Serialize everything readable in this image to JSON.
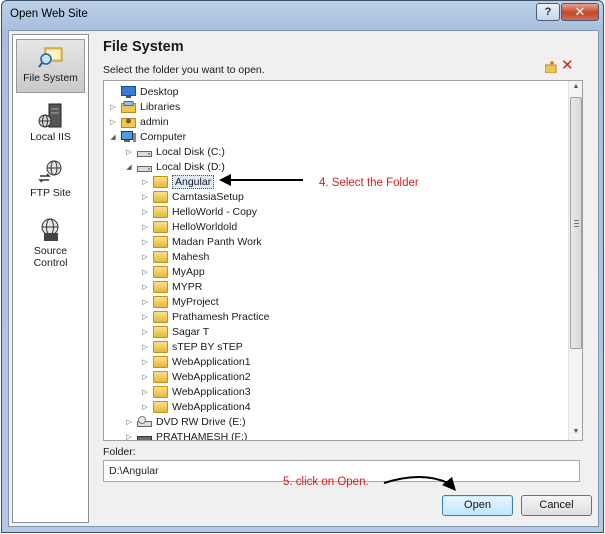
{
  "window": {
    "title": "Open Web Site",
    "help_label": "?",
    "close_label": "✕"
  },
  "sidebar": {
    "items": [
      {
        "label": "File System",
        "icon": "folder-search-icon",
        "selected": true
      },
      {
        "label": "Local IIS",
        "icon": "server-icon",
        "selected": false
      },
      {
        "label": "FTP Site",
        "icon": "ftp-globe-icon",
        "selected": false
      },
      {
        "label": "Source Control",
        "icon": "source-control-icon",
        "selected": false
      }
    ]
  },
  "panel": {
    "heading": "File System",
    "instruction": "Select the folder you want to open."
  },
  "tree": {
    "items": [
      {
        "label": "Desktop",
        "icon": "desktop-icon",
        "expander": "",
        "selected": false
      },
      {
        "label": "Libraries",
        "icon": "libraries-icon",
        "expander": "collapsed",
        "selected": false
      },
      {
        "label": "admin",
        "icon": "user-icon",
        "expander": "collapsed",
        "selected": false
      },
      {
        "label": "Computer",
        "icon": "computer-icon",
        "expander": "expanded",
        "selected": false
      },
      {
        "label": "Local Disk (C:)",
        "icon": "drive-icon",
        "expander": "collapsed",
        "selected": false
      },
      {
        "label": "Local Disk (D:)",
        "icon": "drive-icon",
        "expander": "expanded",
        "selected": false
      },
      {
        "label": "Angular",
        "icon": "folder-icon",
        "expander": "collapsed",
        "selected": true
      },
      {
        "label": "CamtasiaSetup",
        "icon": "folder-icon",
        "expander": "collapsed",
        "selected": false
      },
      {
        "label": "HelloWorld - Copy",
        "icon": "folder-icon",
        "expander": "collapsed",
        "selected": false
      },
      {
        "label": "HelloWorldold",
        "icon": "folder-icon",
        "expander": "collapsed",
        "selected": false
      },
      {
        "label": "Madan Panth Work",
        "icon": "folder-icon",
        "expander": "collapsed",
        "selected": false
      },
      {
        "label": "Mahesh",
        "icon": "folder-icon",
        "expander": "collapsed",
        "selected": false
      },
      {
        "label": "MyApp",
        "icon": "folder-icon",
        "expander": "collapsed",
        "selected": false
      },
      {
        "label": "MYPR",
        "icon": "folder-icon",
        "expander": "collapsed",
        "selected": false
      },
      {
        "label": "MyProject",
        "icon": "folder-icon",
        "expander": "collapsed",
        "selected": false
      },
      {
        "label": "Prathamesh Practice",
        "icon": "folder-icon",
        "expander": "collapsed",
        "selected": false
      },
      {
        "label": "Sagar T",
        "icon": "folder-icon",
        "expander": "collapsed",
        "selected": false
      },
      {
        "label": "sTEP BY sTEP",
        "icon": "folder-icon",
        "expander": "collapsed",
        "selected": false
      },
      {
        "label": "WebApplication1",
        "icon": "folder-icon",
        "expander": "collapsed",
        "selected": false
      },
      {
        "label": "WebApplication2",
        "icon": "folder-icon",
        "expander": "collapsed",
        "selected": false
      },
      {
        "label": "WebApplication3",
        "icon": "folder-icon",
        "expander": "collapsed",
        "selected": false
      },
      {
        "label": "WebApplication4",
        "icon": "folder-icon",
        "expander": "collapsed",
        "selected": false
      },
      {
        "label": "DVD RW Drive (E:)",
        "icon": "dvd-drive-icon",
        "expander": "collapsed",
        "selected": false
      },
      {
        "label": "PRATHAMESH (F:)",
        "icon": "usb-drive-icon",
        "expander": "collapsed",
        "selected": false
      }
    ]
  },
  "folder_field": {
    "label": "Folder:",
    "value": "D:\\Angular"
  },
  "buttons": {
    "open": "Open",
    "cancel": "Cancel"
  },
  "annotations": {
    "select_folder": "4. Select the Folder",
    "click_open": "5. click on Open."
  },
  "colors": {
    "annotation": "#d21e1e",
    "folder": "#e6b83a",
    "close_button": "#c4482d"
  }
}
